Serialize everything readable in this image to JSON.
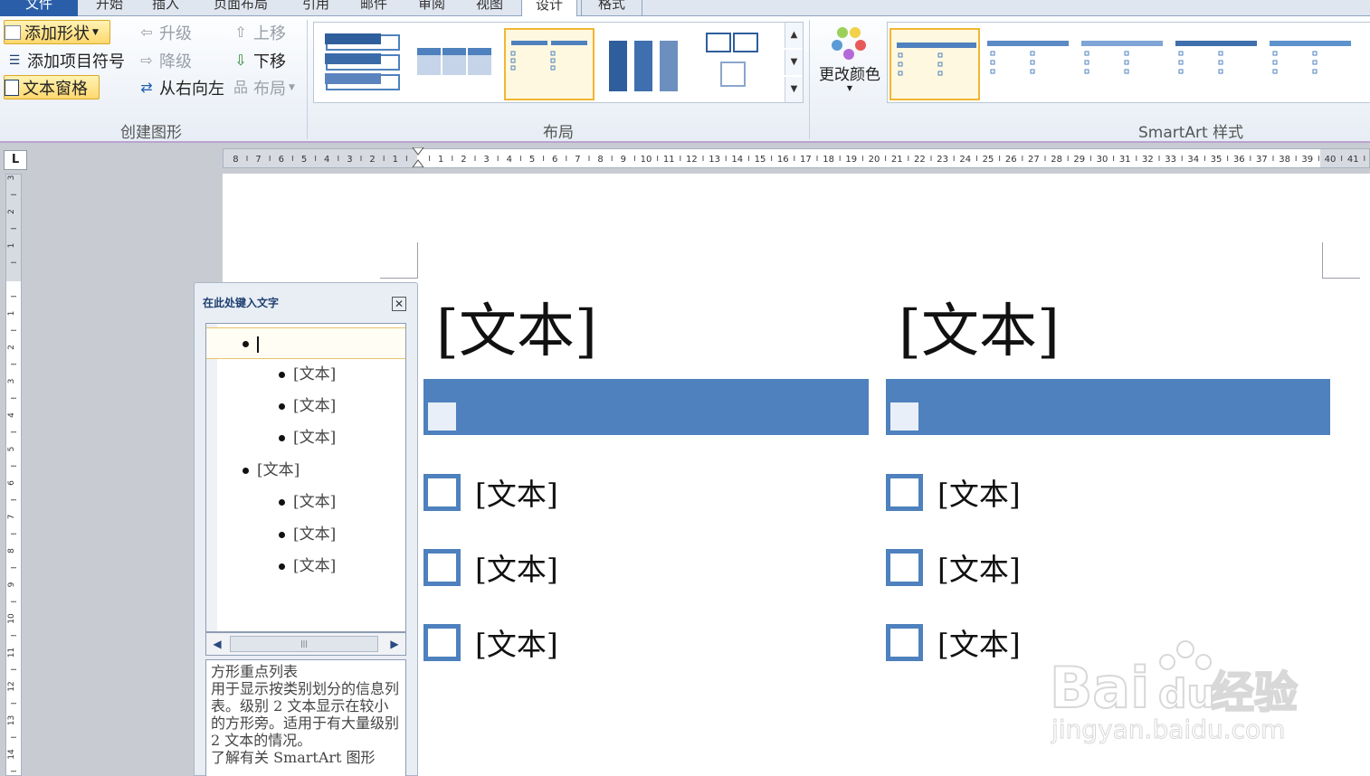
{
  "tabs": [
    {
      "label": "文件"
    },
    {
      "label": "开始"
    },
    {
      "label": "插入"
    },
    {
      "label": "页面布局"
    },
    {
      "label": "引用"
    },
    {
      "label": "邮件"
    },
    {
      "label": "审阅"
    },
    {
      "label": "视图"
    },
    {
      "label": "设计"
    },
    {
      "label": "格式"
    }
  ],
  "ribbon": {
    "create": {
      "label": "创建图形",
      "add_shape": "添加形状",
      "add_bullet": "添加项目符号",
      "text_pane": "文本窗格",
      "promote": "升级",
      "demote": "降级",
      "rtl": "从右向左",
      "move_up": "上移",
      "move_down": "下移",
      "layout": "布局"
    },
    "layouts": {
      "label": "布局"
    },
    "styles": {
      "label": "SmartArt 样式",
      "change_colors": "更改颜色"
    }
  },
  "textpane": {
    "title": "在此处键入文字",
    "items": [
      {
        "level": 1,
        "text": "",
        "active": true
      },
      {
        "level": 2,
        "text": "[文本]"
      },
      {
        "level": 2,
        "text": "[文本]"
      },
      {
        "level": 2,
        "text": "[文本]"
      },
      {
        "level": 1,
        "text": "[文本]"
      },
      {
        "level": 2,
        "text": "[文本]"
      },
      {
        "level": 2,
        "text": "[文本]"
      },
      {
        "level": 2,
        "text": "[文本]"
      }
    ],
    "description": {
      "title": "方形重点列表",
      "body": "用于显示按类别划分的信息列表。级别 2 文本显示在较小的方形旁。适用于有大量级别 2 文本的情况。",
      "more": "了解有关 SmartArt 图形"
    }
  },
  "smartart": {
    "columns": [
      {
        "title": "[文本]",
        "items": [
          "[文本]",
          "[文本]",
          "[文本]"
        ]
      },
      {
        "title": "[文本]",
        "items": [
          "[文本]",
          "[文本]",
          "[文本]"
        ]
      }
    ]
  },
  "colors": {
    "accent": "#4e81bd",
    "highlight": "#ffd86e",
    "ribbon_border": "#b9a3cf"
  }
}
